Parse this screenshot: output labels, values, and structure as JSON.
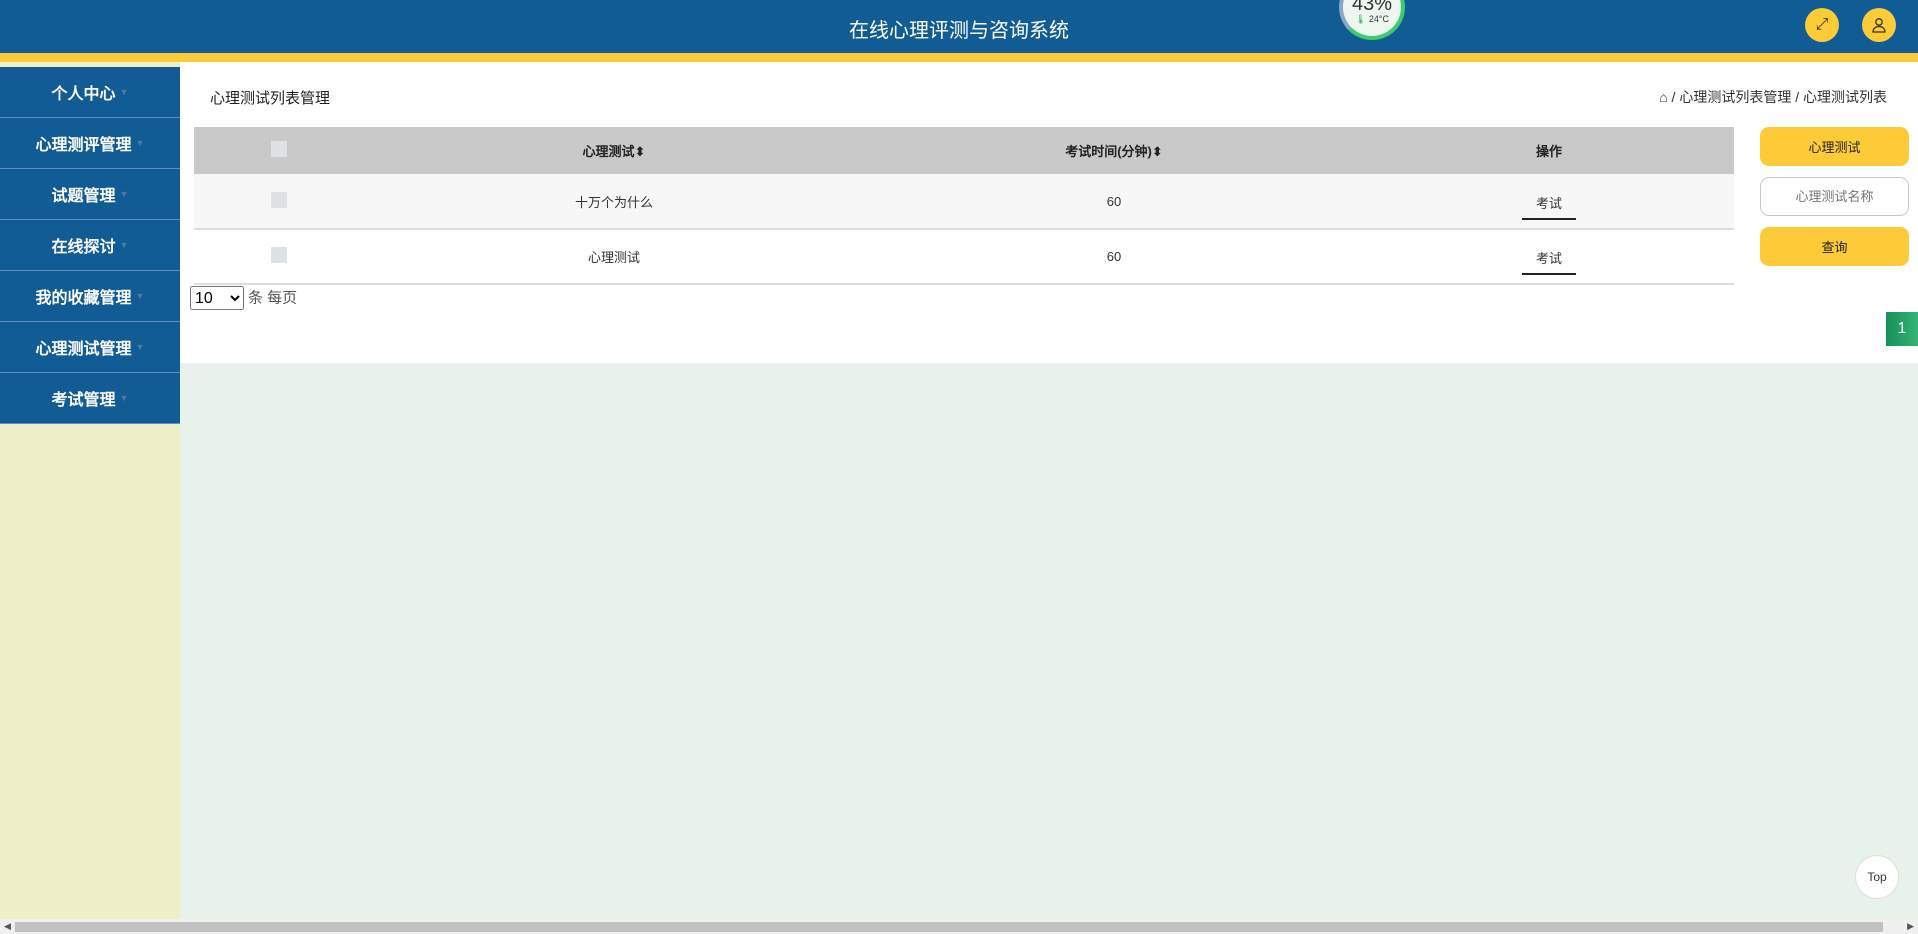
{
  "header": {
    "title": "在线心理评测与咨询系统",
    "weather": {
      "humidity": "43%",
      "temperature": "24°C"
    },
    "fullscreen_icon": "expand-icon",
    "user_icon": "user-icon"
  },
  "sidebar": {
    "items": [
      {
        "label": "个人中心"
      },
      {
        "label": "心理测评管理"
      },
      {
        "label": "试题管理"
      },
      {
        "label": "在线探讨"
      },
      {
        "label": "我的收藏管理"
      },
      {
        "label": "心理测试管理"
      },
      {
        "label": "考试管理"
      }
    ]
  },
  "main": {
    "page_title": "心理测试列表管理",
    "breadcrumb": [
      "心理测试列表管理",
      "心理测试列表"
    ],
    "table": {
      "headers": [
        "心理测试",
        "考试时间(分钟)",
        "操作"
      ],
      "rows": [
        {
          "name": "十万个为什么",
          "time": "60",
          "action": "考试"
        },
        {
          "name": "心理测试",
          "time": "60",
          "action": "考试"
        }
      ]
    },
    "pagination": {
      "page_size": "10",
      "page_size_suffix": "条 每页",
      "current_page": "1"
    },
    "side": {
      "category_button": "心理测试",
      "search_placeholder": "心理测试名称",
      "search_button": "查询"
    }
  },
  "back_to_top": "Top",
  "colors": {
    "header": "#115c94",
    "accent": "#fccb37",
    "sidebar_bg": "#eeeec8",
    "page_bg": "#e6f2ea",
    "page_active": "#15915a"
  }
}
